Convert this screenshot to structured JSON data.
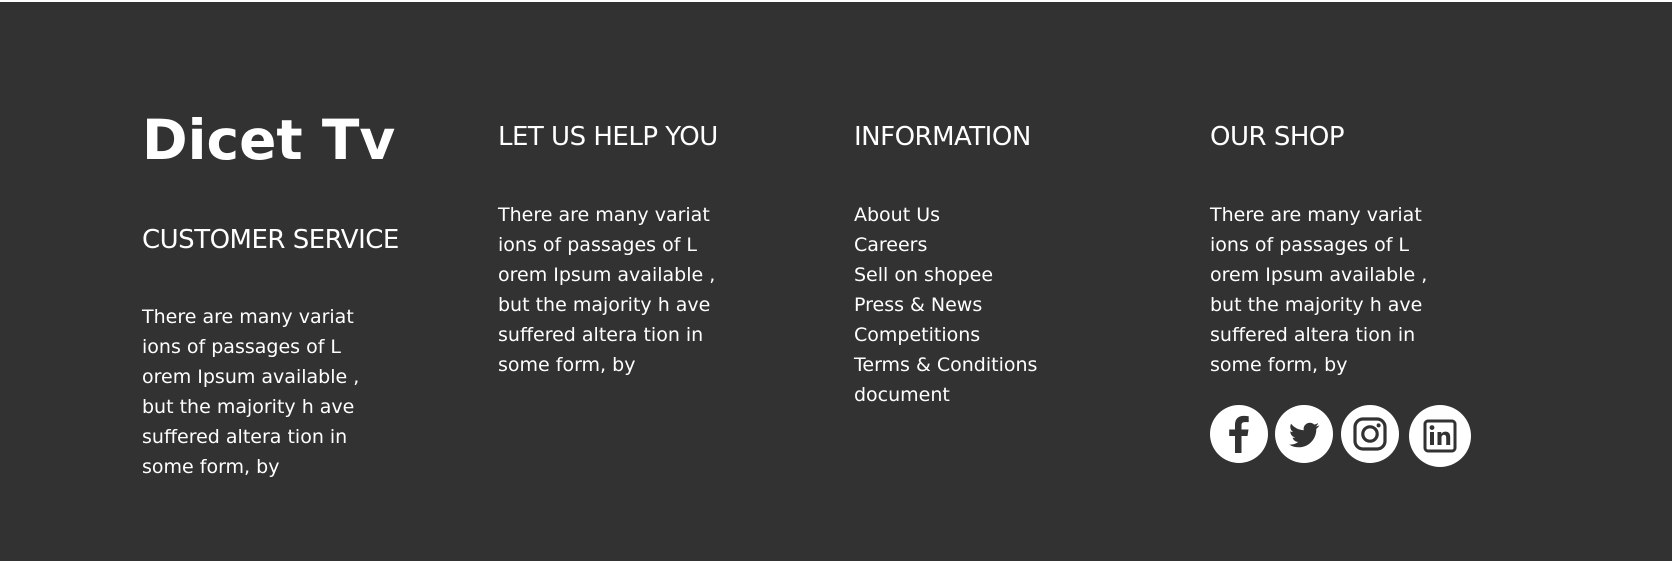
{
  "brand": {
    "logo_text": "Dicet Tv"
  },
  "customer_service": {
    "heading": "CUSTOMER SERVICE",
    "text_lines": [
      "There are many variat",
      "ions of passages of L",
      "orem Ipsum available ,",
      "but the majority h ave",
      "suffered altera tion in",
      "some form, by"
    ]
  },
  "help": {
    "heading": "LET US HELP YOU",
    "text_lines": [
      "There are many variat",
      "ions of passages of L",
      "orem Ipsum available ,",
      "but the majority h ave",
      "suffered altera tion in",
      "some form, by"
    ]
  },
  "information": {
    "heading": "INFORMATION",
    "links": [
      "About Us",
      "Careers",
      "Sell on shopee",
      "Press & News",
      "Competitions",
      "Terms & Conditions",
      "document"
    ]
  },
  "shop": {
    "heading": "OUR SHOP",
    "text_lines": [
      "There are many variat",
      "ions of passages of L",
      "orem Ipsum available ,",
      "but the majority h ave",
      "suffered altera tion in",
      "some form, by"
    ]
  },
  "social": {
    "icons": [
      "facebook-icon",
      "twitter-icon",
      "instagram-icon",
      "linkedin-icon"
    ]
  },
  "colors": {
    "background": "#323232",
    "text": "#ffffff",
    "icon_fill": "#ffffff",
    "icon_glyph": "#323232"
  }
}
